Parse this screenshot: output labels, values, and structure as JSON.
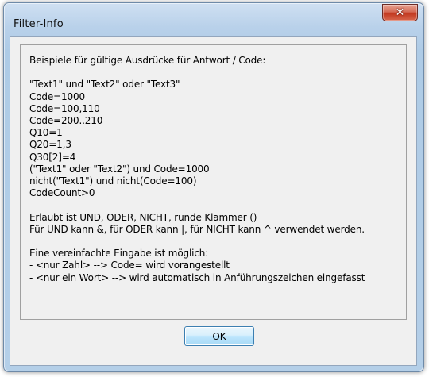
{
  "window": {
    "title": "Filter-Info",
    "close_icon": "close-icon"
  },
  "info": {
    "lines": [
      "Beispiele für gültige Ausdrücke für Antwort / Code:",
      "",
      "\"Text1\" und \"Text2\" oder \"Text3\"",
      "Code=1000",
      "Code=100,110",
      "Code=200..210",
      "Q10=1",
      "Q20=1,3",
      "Q30[2]=4",
      "(\"Text1\" oder \"Text2\") und Code=1000",
      "nicht(\"Text1\") und nicht(Code=100)",
      "CodeCount>0",
      "",
      "Erlaubt ist UND, ODER, NICHT, runde Klammer ()",
      "Für UND kann &, für ODER kann |, für NICHT kann ^ verwendet werden.",
      "",
      "Eine vereinfachte Eingabe ist möglich:",
      "- <nur Zahl> --> Code= wird vorangestellt",
      "- <nur ein Wort> --> wird automatisch in Anführungszeichen eingefasst"
    ]
  },
  "buttons": {
    "ok_label": "OK"
  }
}
